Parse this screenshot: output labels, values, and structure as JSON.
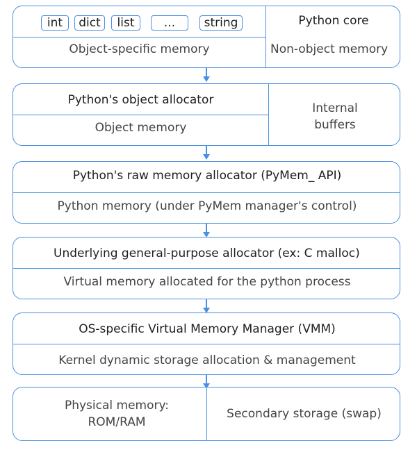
{
  "layers": [
    {
      "tags": [
        "int",
        "dict",
        "list",
        "...",
        "string"
      ],
      "left_label": "Object-specific memory",
      "right_top": "Python core",
      "right_bottom": "Non-object memory"
    },
    {
      "left_top": "Python's object allocator",
      "left_bottom": "Object memory",
      "right_line1": "Internal",
      "right_line2": "buffers"
    },
    {
      "top": "Python's raw memory allocator (PyMem_ API)",
      "bottom": "Python memory (under PyMem manager's control)"
    },
    {
      "top": "Underlying general-purpose allocator (ex: C malloc)",
      "bottom": "Virtual memory allocated for the python process"
    },
    {
      "top": "OS-specific Virtual Memory Manager (VMM)",
      "bottom": "Kernel dynamic storage allocation & management"
    },
    {
      "left_line1": "Physical memory:",
      "left_line2": "ROM/RAM",
      "right": "Secondary storage (swap)"
    }
  ],
  "colors": {
    "accent": "#4a90e2"
  }
}
